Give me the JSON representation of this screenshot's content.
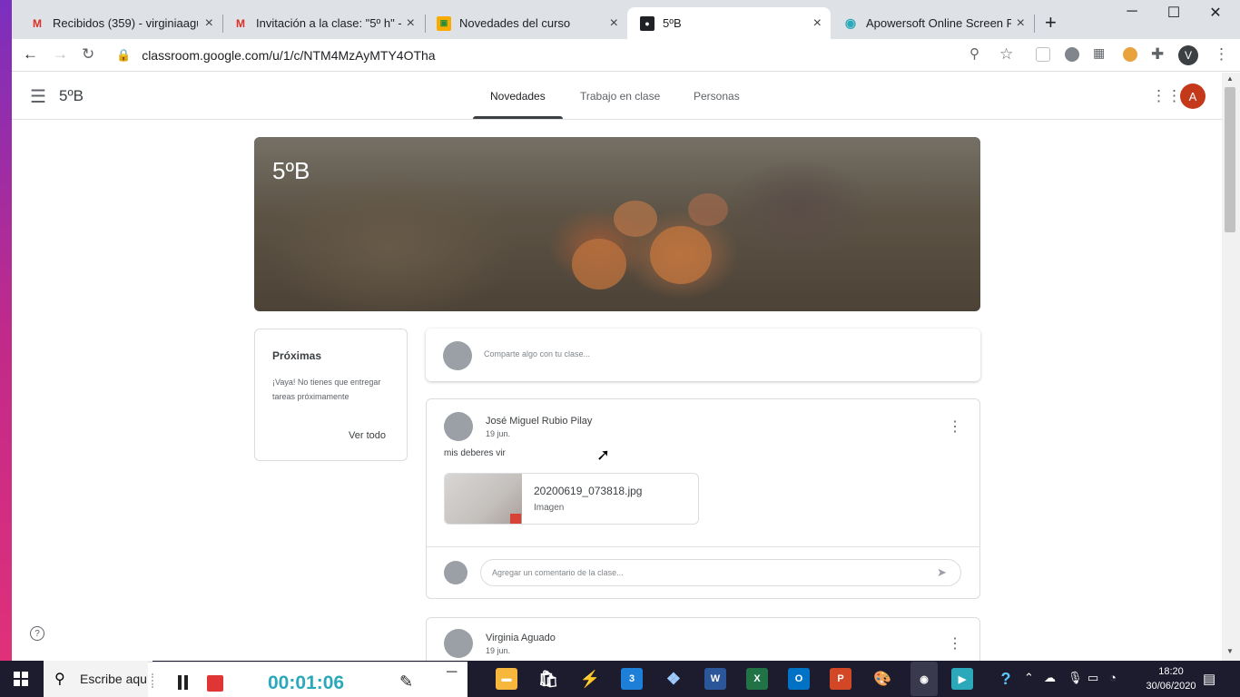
{
  "browser": {
    "tabs": [
      {
        "title": "Recibidos (359) - virginiaaguado",
        "favicon": "gmail-icon",
        "color": "#d93025"
      },
      {
        "title": "Invitación a la clase: \"5º h\" - a",
        "favicon": "gmail-icon",
        "color": "#d93025"
      },
      {
        "title": "Novedades del curso",
        "favicon": "classroom-icon",
        "color": "#f9ab00"
      },
      {
        "title": "5ºB",
        "favicon": "classroom-person-icon",
        "color": "#202124"
      },
      {
        "title": "Apowersoft Online Screen Rec",
        "favicon": "apowersoft-icon",
        "color": "#2ba8b9"
      }
    ],
    "new_tab": "+",
    "url": "classroom.google.com/u/1/c/NTM4MzAyMTY4OTha",
    "profile_initial": "V"
  },
  "classroom": {
    "class_name": "5ºB",
    "nav_tabs": [
      "Novedades",
      "Trabajo en clase",
      "Personas"
    ],
    "account_initial": "A",
    "banner_title": "5ºB",
    "upcoming": {
      "title": "Próximas",
      "text": "¡Vaya! No tienes que entregar tareas próximamente",
      "link": "Ver todo"
    },
    "share_placeholder": "Comparte algo con tu clase...",
    "posts": [
      {
        "author": "José Miguel Rubio Pilay",
        "date": "19 jun.",
        "body": "mis deberes vir",
        "attachment": {
          "name": "20200619_073818.jpg",
          "type": "Imagen"
        },
        "comment_placeholder": "Agregar un comentario de la clase..."
      },
      {
        "author": "Virginia Aguado",
        "date": "19 jun."
      }
    ]
  },
  "taskbar": {
    "search_text": "Escribe aquí",
    "mail_badge": "3",
    "time": "18:20",
    "date": "30/06/2020"
  },
  "recorder": {
    "timer": "00:01:06"
  },
  "colors": {
    "accent_red": "#c5391b",
    "recorder_teal": "#2ba8b9"
  }
}
